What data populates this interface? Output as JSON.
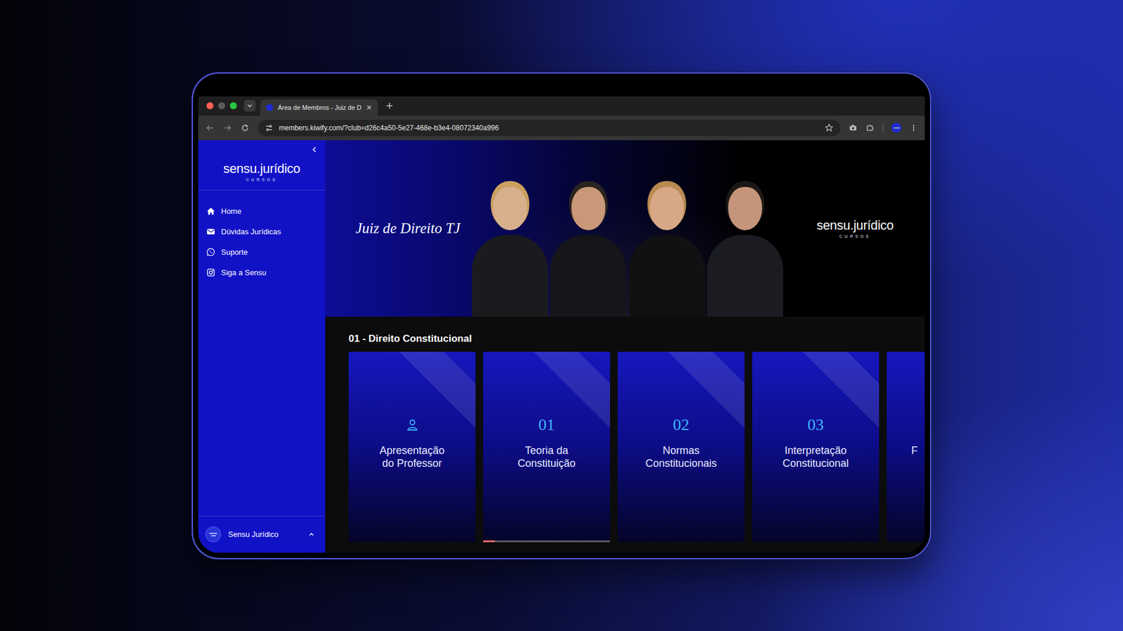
{
  "browser": {
    "tab_title": "Área de Membros - Juiz de D",
    "url": "members.kiwify.com/?club=d26c4a50-5e27-468e-b3e4-08072340a996"
  },
  "sidebar": {
    "logo": "sensu.jurídico",
    "logo_sub": "CURSOS",
    "items": [
      {
        "label": "Home"
      },
      {
        "label": "Dúvidas Jurídicas"
      },
      {
        "label": "Suporte"
      },
      {
        "label": "Siga a Sensu"
      }
    ],
    "user": {
      "name": "Sensu Jurídico"
    }
  },
  "banner": {
    "title": "Juiz de Direito TJ",
    "logo": "sensu.jurídico",
    "logo_sub": "CURSOS"
  },
  "section": {
    "title": "01 - Direito Constitucional",
    "cards": [
      {
        "kind": "icon",
        "title": "Apresentação do Professor"
      },
      {
        "kind": "number",
        "number": "01",
        "title": "Teoria da Constituição",
        "level": 0.09
      },
      {
        "kind": "number",
        "number": "02",
        "title": "Normas Constitucionais"
      },
      {
        "kind": "number",
        "number": "03",
        "title": "Interpretação Constitucional"
      },
      {
        "kind": "partial",
        "title": "F"
      }
    ]
  }
}
